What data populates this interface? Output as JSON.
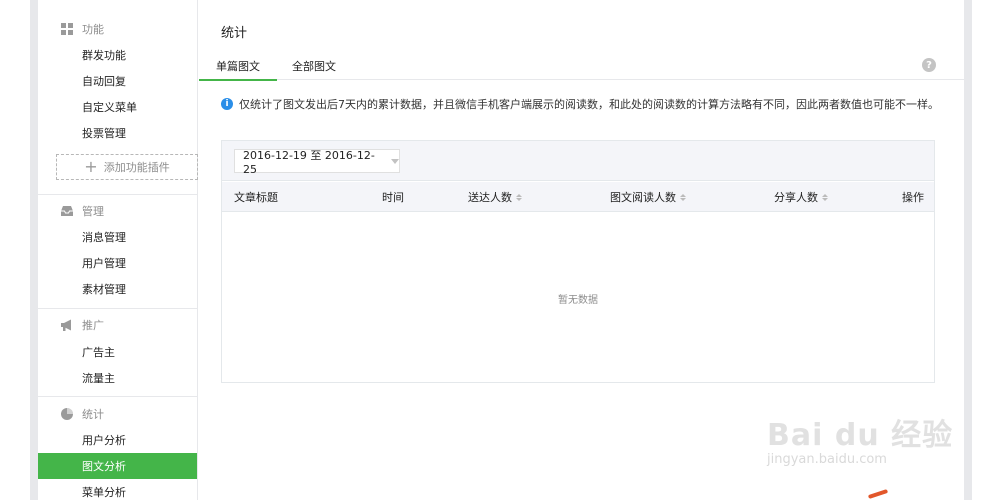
{
  "sidebar": {
    "sections": [
      {
        "title": "功能",
        "icon": "grid-icon",
        "items": [
          "群发功能",
          "自动回复",
          "自定义菜单",
          "投票管理"
        ]
      },
      {
        "title": "管理",
        "icon": "inbox-icon",
        "items": [
          "消息管理",
          "用户管理",
          "素材管理"
        ]
      },
      {
        "title": "推广",
        "icon": "megaphone-icon",
        "items": [
          "广告主",
          "流量主"
        ]
      },
      {
        "title": "统计",
        "icon": "pie-chart-icon",
        "items": [
          "用户分析",
          "图文分析",
          "菜单分析"
        ]
      }
    ],
    "add_plugin_label": "添加功能插件",
    "active_item": "图文分析"
  },
  "main": {
    "title": "统计",
    "tabs": [
      {
        "label": "单篇图文",
        "active": true
      },
      {
        "label": "全部图文",
        "active": false
      }
    ],
    "notice": "仅统计了图文发出后7天内的累计数据，并且微信手机客户端展示的阅读数，和此处的阅读数的计算方法略有不同，因此两者数值也可能不一样。",
    "date_range": "2016-12-19 至 2016-12-25",
    "table": {
      "columns": [
        {
          "label": "文章标题",
          "sortable": false
        },
        {
          "label": "时间",
          "sortable": false
        },
        {
          "label": "送达人数",
          "sortable": true
        },
        {
          "label": "图文阅读人数",
          "sortable": true
        },
        {
          "label": "分享人数",
          "sortable": true
        },
        {
          "label": "操作",
          "sortable": false
        }
      ],
      "empty_text": "暂无数据"
    }
  },
  "watermark": {
    "brand": "Bai du 经验",
    "url": "jingyan.baidu.com"
  },
  "colors": {
    "accent": "#44b549",
    "info": "#2a8ee8"
  }
}
